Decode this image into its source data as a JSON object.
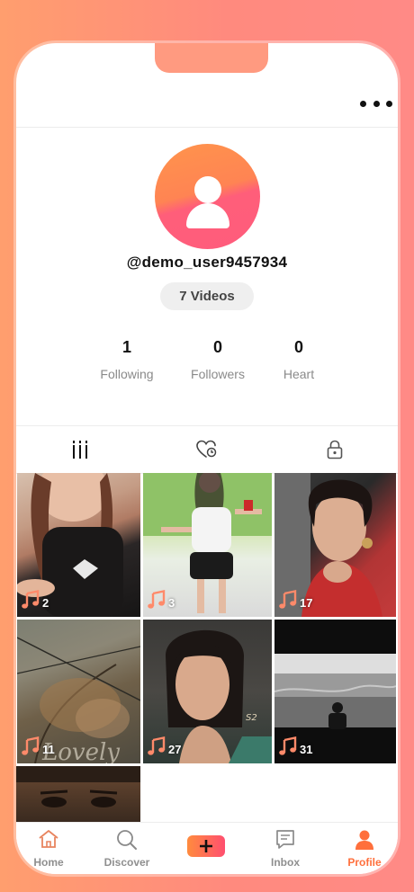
{
  "profile": {
    "username": "@demo_user9457934",
    "videos_label": "7 Videos",
    "stats": [
      {
        "value": "1",
        "label": "Following"
      },
      {
        "value": "0",
        "label": "Followers"
      },
      {
        "value": "0",
        "label": "Heart"
      }
    ]
  },
  "tabs": [
    {
      "icon": "grid-bars-icon",
      "active": true
    },
    {
      "icon": "heart-icon",
      "active": false
    },
    {
      "icon": "lock-icon",
      "active": false
    }
  ],
  "videos": [
    {
      "count": "2"
    },
    {
      "count": "3"
    },
    {
      "count": "17"
    },
    {
      "count": "11"
    },
    {
      "count": "27"
    },
    {
      "count": "31"
    },
    {
      "count": ""
    }
  ],
  "nav": {
    "items": [
      {
        "label": "Home",
        "icon": "home-icon"
      },
      {
        "label": "Discover",
        "icon": "search-icon"
      },
      {
        "label": "",
        "icon": "plus-icon"
      },
      {
        "label": "Inbox",
        "icon": "message-icon"
      },
      {
        "label": "Profile",
        "icon": "person-icon"
      }
    ],
    "active_index": 4
  },
  "colors": {
    "accent": "#ff6f4b",
    "active_nav": "#ff6f3c",
    "nav_text": "#8f8f8f"
  }
}
